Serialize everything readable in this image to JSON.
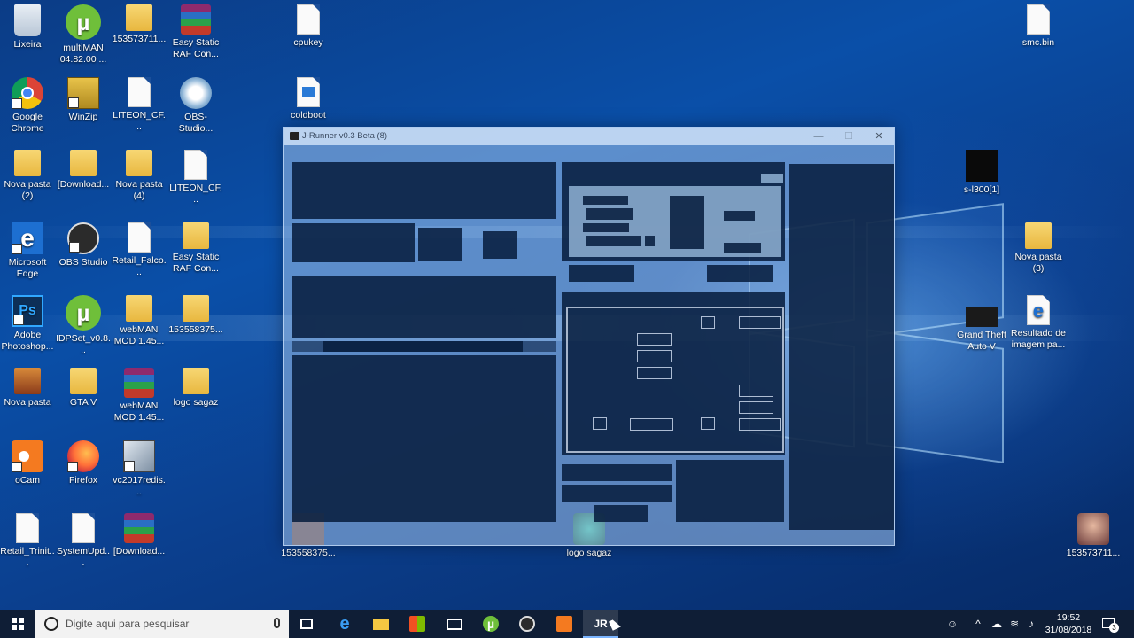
{
  "desktop": {
    "icons": [
      {
        "label": "Lixeira",
        "icon": "recycle-bin-icon"
      },
      {
        "label": "multiMAN 04.82.00 ...",
        "icon": "utorrent-icon"
      },
      {
        "label": "153573711...",
        "icon": "image-folder-icon"
      },
      {
        "label": "Easy Static RAF Con...",
        "icon": "winrar-icon"
      },
      {
        "label": "cpukey",
        "icon": "file-icon"
      },
      {
        "label": "smc.bin",
        "icon": "file-icon"
      },
      {
        "label": "Google Chrome",
        "icon": "chrome-icon"
      },
      {
        "label": "WinZip",
        "icon": "winzip-icon"
      },
      {
        "label": "LITEON_CF...",
        "icon": "file-icon"
      },
      {
        "label": "OBS-Studio...",
        "icon": "nsis-installer-icon"
      },
      {
        "label": "coldboot",
        "icon": "image-file-icon"
      },
      {
        "label": "Nova pasta (2)",
        "icon": "folder-icon"
      },
      {
        "label": "[Download...",
        "icon": "folder-icon"
      },
      {
        "label": "Nova pasta (4)",
        "icon": "folder-icon"
      },
      {
        "label": "LITEON_CF...",
        "icon": "file-icon"
      },
      {
        "label": "s-l300[1]",
        "icon": "image-thumbnail-icon"
      },
      {
        "label": "Microsoft Edge",
        "icon": "edge-icon"
      },
      {
        "label": "OBS Studio",
        "icon": "obs-icon"
      },
      {
        "label": "Retail_Falco...",
        "icon": "file-icon"
      },
      {
        "label": "Easy Static RAF Con...",
        "icon": "folder-icon"
      },
      {
        "label": "Nova pasta (3)",
        "icon": "folder-icon"
      },
      {
        "label": "Adobe Photoshop...",
        "icon": "photoshop-icon"
      },
      {
        "label": "IDPSet_v0.8...",
        "icon": "utorrent-icon"
      },
      {
        "label": "webMAN MOD 1.45...",
        "icon": "folder-icon"
      },
      {
        "label": "153558375...",
        "icon": "image-folder-icon"
      },
      {
        "label": "Grand Theft Auto V",
        "icon": "gta-v-icon"
      },
      {
        "label": "Resultado de imagem pa...",
        "icon": "edge-html-icon"
      },
      {
        "label": "Nova pasta",
        "icon": "folder-icon"
      },
      {
        "label": "GTA V",
        "icon": "folder-icon"
      },
      {
        "label": "webMAN MOD 1.45...",
        "icon": "winrar-icon"
      },
      {
        "label": "logo sagaz",
        "icon": "folder-icon"
      },
      {
        "label": "oCam",
        "icon": "ocam-icon"
      },
      {
        "label": "Firefox",
        "icon": "firefox-icon"
      },
      {
        "label": "vc2017redis...",
        "icon": "installer-icon"
      },
      {
        "label": "Retail_Trinit...",
        "icon": "file-icon"
      },
      {
        "label": "SystemUpd...",
        "icon": "file-icon"
      },
      {
        "label": "[Download...",
        "icon": "winrar-icon"
      },
      {
        "label": "153558375...",
        "icon": "image-thumbnail-icon"
      },
      {
        "label": "logo sagaz",
        "icon": "image-thumbnail-icon"
      },
      {
        "label": "153573711...",
        "icon": "image-thumbnail-icon"
      }
    ]
  },
  "window": {
    "title": "J-Runner v0.3 Beta (8)",
    "minimize": "—",
    "maximize": "☐",
    "close": "✕"
  },
  "taskbar": {
    "search_placeholder": "Digite aqui para pesquisar",
    "apps": [
      "task-view",
      "edge",
      "file-explorer",
      "store",
      "mail",
      "utorrent",
      "obs",
      "ocam",
      "j-runner"
    ],
    "time": "19:52",
    "date": "31/08/2018",
    "notification_count": "3"
  },
  "colors": {
    "accent": "#0a4fa8",
    "taskbar": "#0f1e36"
  }
}
